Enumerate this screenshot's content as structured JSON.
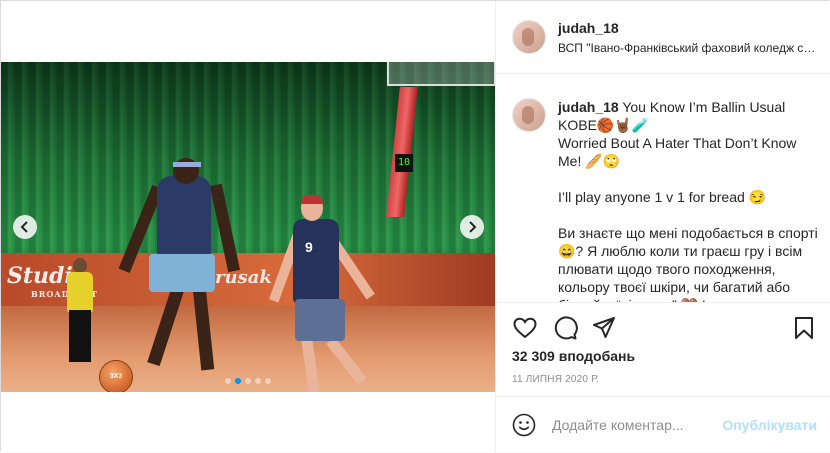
{
  "post": {
    "username": "judah_18",
    "location": "ВСП \"Івано-Франківський фаховий коледж спорту\"",
    "caption": " You Know I’m Ballin Usual KOBE🏀🤘🏾🧪\nWorried Bout A Hater That Don’t Know Me! 🥖🙄\n\nI’ll play anyone 1 v 1 for bread 😏\n\nВи знаєте що мені подобається в спорті😄? Я люблю коли ти граєш гру і всім плювати щодо твого походження, кольору твоєї шкіри, чи багатий або бідний – “ніхто не” 🤎 І ти",
    "likes": "32 309 вподобань",
    "date": "11 ЛИПНЯ 2020 Р.",
    "image": {
      "banner_text": "Studio",
      "banner_sub": "BROADCAST",
      "banner_text2": "rusak",
      "player_number": "9",
      "shot_clock": "10",
      "ball_text": "3X3",
      "total_slides": 5,
      "active_slide": 1
    }
  },
  "comment": {
    "placeholder": "Додайте коментар...",
    "post_label": "Опублікувати"
  },
  "icons": {
    "prev": "chevron-left-icon",
    "next": "chevron-right-icon",
    "like": "heart-icon",
    "comment": "comment-icon",
    "share": "share-icon",
    "save": "bookmark-icon",
    "emoji": "smiley-icon"
  },
  "colors": {
    "link_blue": "#0095f6",
    "post_button_disabled": "#b2dffc",
    "text": "#262626",
    "muted": "#8e8e8e",
    "border": "#dbdbdb"
  }
}
